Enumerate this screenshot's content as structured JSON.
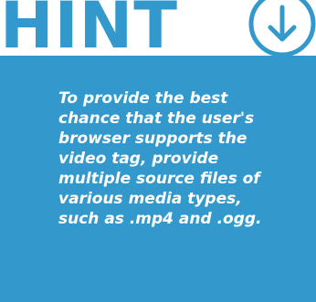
{
  "header": {
    "title": "HINT",
    "icon": "download-circle-icon"
  },
  "panel": {
    "text": "To provide the best chance that the user's browser supports the video tag, provide multiple source files of various media types, such as .mp4 and .ogg."
  },
  "colors": {
    "accent": "#3399cc",
    "text_on_accent": "#ffffff"
  }
}
